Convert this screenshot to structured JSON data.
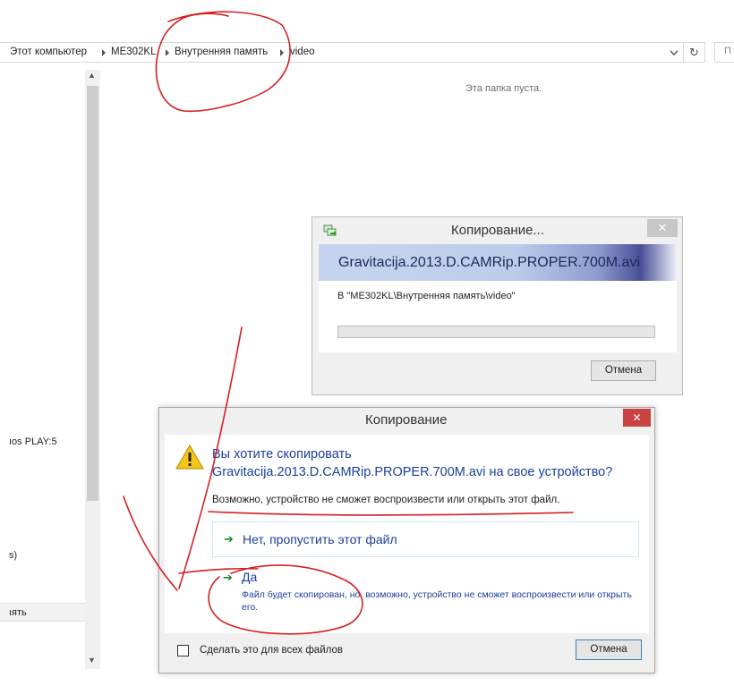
{
  "address_bar": {
    "crumbs": [
      "Этот компьютер",
      "ME302KL",
      "Внутренняя память",
      "video"
    ],
    "search_placeholder": "П"
  },
  "nav_pane": {
    "items": [
      "ıos PLAY:5",
      "s)",
      "ıять"
    ]
  },
  "content": {
    "empty_message": "Эта папка пуста."
  },
  "progress_dialog": {
    "title": "Копирование...",
    "file_name": "Gravitacija.2013.D.CAMRip.PROPER.700M.avi",
    "destination": "В \"ME302KL\\Внутренняя память\\video\"",
    "progress": 0,
    "cancel_label": "Отмена",
    "close_glyph": "✕"
  },
  "confirm_dialog": {
    "title": "Копирование",
    "close_glyph": "✕",
    "question_line1": "Вы хотите скопировать",
    "question_line2": "Gravitacija.2013.D.CAMRip.PROPER.700M.avi на свое устройство?",
    "note": "Возможно, устройство не сможет воспроизвести или открыть этот файл.",
    "option_no": "Нет, пропустить этот файл",
    "option_yes": "Да",
    "option_yes_description": "Файл будет скопирован, но, возможно, устройство не сможет воспроизвести или открыть его.",
    "apply_all_label": "Сделать это для всех файлов",
    "cancel_label": "Отмена"
  },
  "icons": {
    "arrow": "➔",
    "refresh": "↻",
    "scroll_up": "▲",
    "scroll_down": "▼"
  },
  "colors": {
    "annotation_red": "#d42020",
    "link_blue": "#1b3f9a",
    "close_red": "#c94343",
    "arrow_green": "#1e8a2a"
  }
}
